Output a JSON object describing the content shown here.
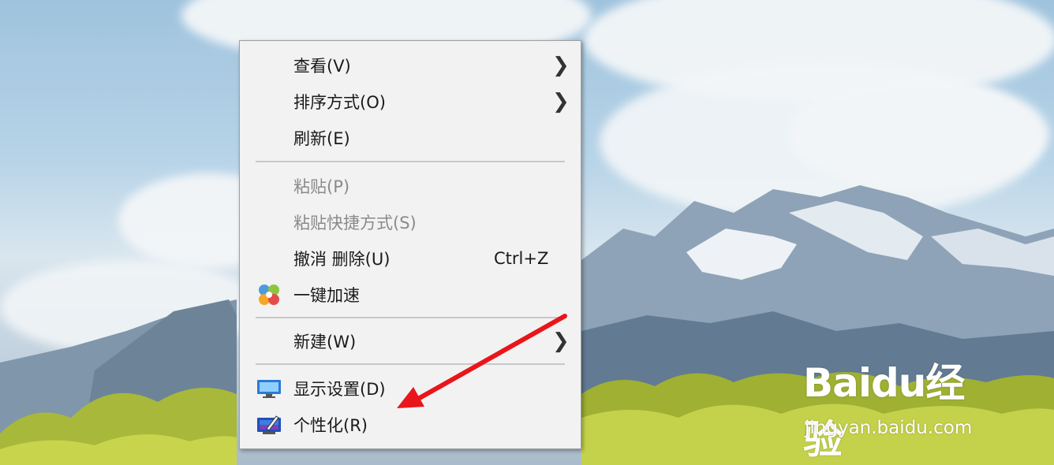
{
  "menu": {
    "items": [
      {
        "label": "查看(V)",
        "submenu": true
      },
      {
        "label": "排序方式(O)",
        "submenu": true
      },
      {
        "label": "刷新(E)"
      },
      {
        "label": "粘贴(P)",
        "disabled": true
      },
      {
        "label": "粘贴快捷方式(S)",
        "disabled": true
      },
      {
        "label": "撤消 删除(U)",
        "shortcut": "Ctrl+Z"
      },
      {
        "label": "一键加速",
        "icon": "speedup-icon"
      },
      {
        "label": "新建(W)",
        "submenu": true
      },
      {
        "label": "显示设置(D)",
        "icon": "display-settings-icon"
      },
      {
        "label": "个性化(R)",
        "icon": "personalize-icon"
      }
    ],
    "submenu_arrow": "❯"
  },
  "watermark": {
    "logo": "Baidu经验",
    "url": "jingyan.baidu.com"
  },
  "annotation": {
    "color": "#e8161b"
  }
}
